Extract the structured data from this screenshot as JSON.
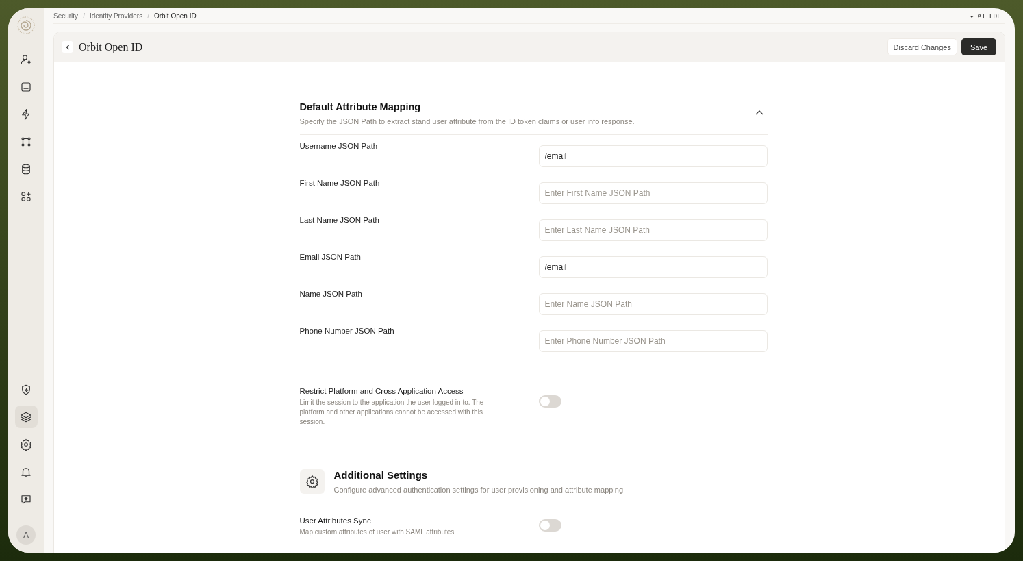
{
  "sidebar": {
    "top_items": [
      {
        "selected": false
      },
      {
        "selected": false
      },
      {
        "selected": false
      },
      {
        "selected": false
      },
      {
        "selected": false
      },
      {
        "selected": false
      }
    ],
    "bottom_items": [
      {
        "selected": false
      },
      {
        "selected": true
      },
      {
        "selected": false
      },
      {
        "selected": false
      },
      {
        "selected": false
      }
    ],
    "avatar": "A"
  },
  "breadcrumb_separator": "/",
  "breadcrumb": [
    {
      "label": "Security",
      "current": false
    },
    {
      "label": "Identity Providers",
      "current": false
    },
    {
      "label": "Orbit Open ID",
      "current": true
    }
  ],
  "assistant": {
    "icon": "✦",
    "label": "AI FDE"
  },
  "page": {
    "title": "Orbit Open ID",
    "buttons": [
      {
        "label": "Discard Changes",
        "kind": "secondary"
      },
      {
        "label": "Save",
        "kind": "primary"
      }
    ]
  },
  "mapping": {
    "title": "Default Attribute Mapping",
    "description": "Specify the JSON Path to extract stand user attribute from the ID token claims or user info response.",
    "expanded": true,
    "fields": [
      {
        "label": "Username JSON Path",
        "value": "/email"
      },
      {
        "label": "First Name JSON Path",
        "placeholder": "Enter First Name JSON Path"
      },
      {
        "label": "Last Name JSON Path",
        "placeholder": "Enter Last Name JSON Path"
      },
      {
        "label": "Email JSON Path",
        "value": "/email"
      },
      {
        "label": "Name JSON Path",
        "placeholder": "Enter Name JSON Path"
      },
      {
        "label": "Phone Number JSON Path",
        "placeholder": "Enter Phone Number JSON Path"
      }
    ]
  },
  "restrict": {
    "title": "Restrict Platform and Cross Application Access",
    "description": "Limit the session to the application the user logged in to. The platform and other applications cannot be accessed with this session.",
    "on": false
  },
  "additional": {
    "title": "Additional Settings",
    "description": "Configure advanced authentication settings for user provisioning and attribute mapping",
    "settings": [
      {
        "title": "User Attributes Sync",
        "description": "Map custom attributes of user with SAML attributes",
        "on": false
      }
    ]
  }
}
